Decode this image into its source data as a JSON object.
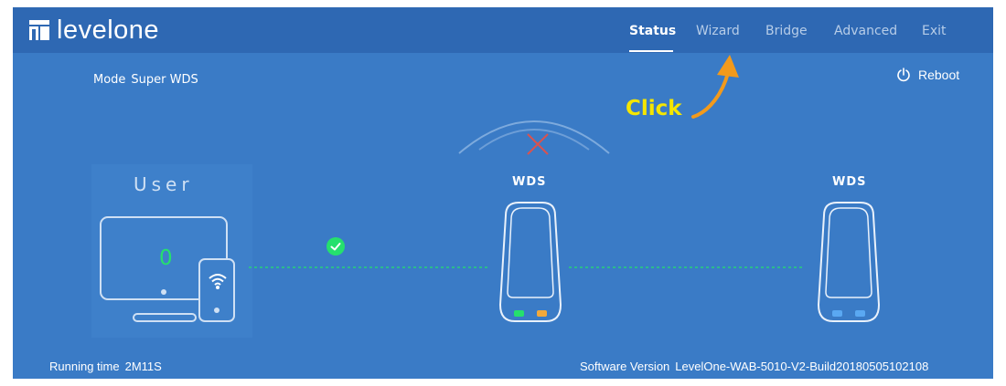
{
  "brand": {
    "name": "levelone"
  },
  "nav": [
    {
      "label": "Status",
      "active": true
    },
    {
      "label": "Wizard",
      "active": false
    },
    {
      "label": "Bridge",
      "active": false
    },
    {
      "label": "Advanced",
      "active": false
    },
    {
      "label": "Exit",
      "active": false
    }
  ],
  "status": {
    "mode_label": "Mode",
    "mode_value": "Super WDS",
    "reboot_label": "Reboot",
    "user_title": "User",
    "user_count": "0",
    "devices": [
      {
        "label": "WDS"
      },
      {
        "label": "WDS"
      }
    ],
    "running_time_label": "Running time",
    "running_time_value": "2M11S",
    "software_version_label": "Software Version",
    "software_version_value": "LevelOne-WAB-5010-V2-Build20180505102108"
  },
  "annotation": {
    "text": "Click"
  },
  "colors": {
    "background": "#3a7bc6",
    "topbar": "#2e68b3",
    "connected": "#25e06d",
    "annotation": "#f5e600",
    "arrow": "#f29a1c",
    "led_amber": "#f2a93b",
    "led_blue": "#5aa8f2",
    "disconnected": "#d9534f"
  },
  "icons": {
    "logo": "levelone-logo-icon",
    "reboot": "power-icon",
    "user": "monitor-and-phone-icon",
    "connected": "check-circle-icon",
    "wifi": "wifi-icon",
    "signal": "signal-arc-icon",
    "disconnected": "x-mark-icon",
    "device": "access-point-icon"
  }
}
